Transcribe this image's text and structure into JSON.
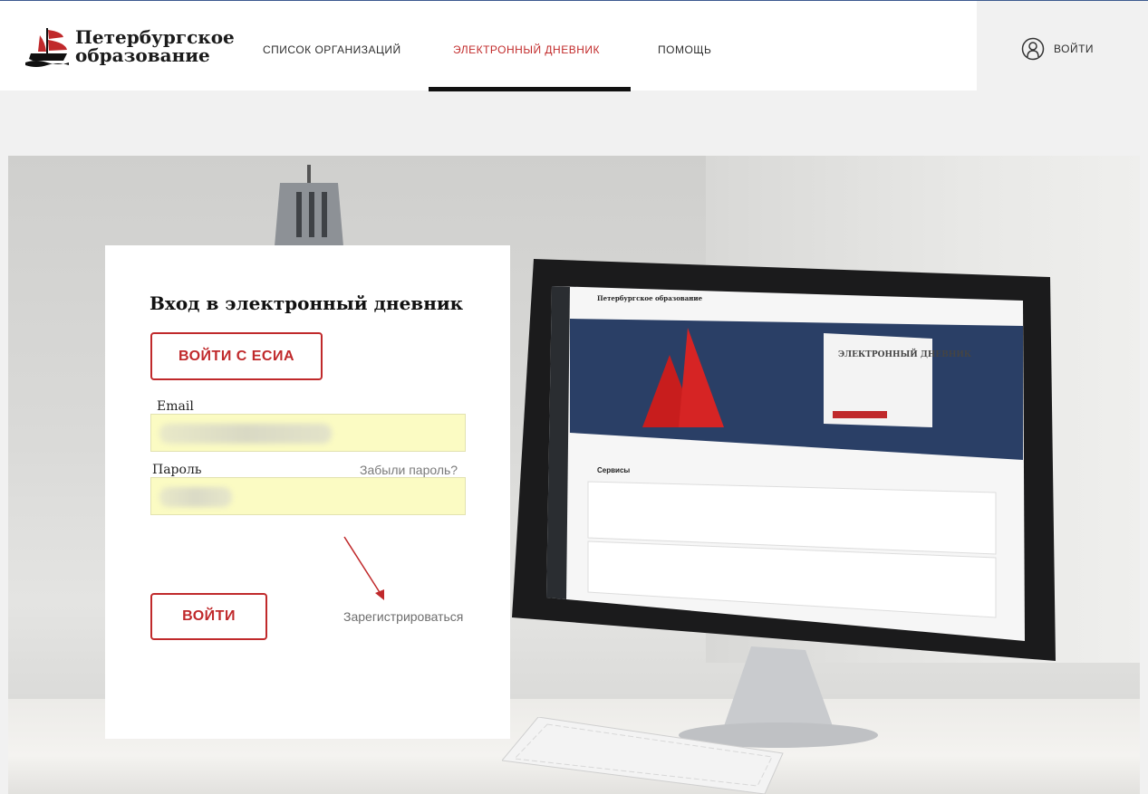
{
  "header": {
    "logo": {
      "line1": "Петербургское",
      "line2": "образование"
    },
    "nav": [
      {
        "label": "СПИСОК ОРГАНИЗАЦИЙ",
        "active": false
      },
      {
        "label": "ЭЛЕКТРОННЫЙ ДНЕВНИК",
        "active": true
      },
      {
        "label": "ПОМОЩЬ",
        "active": false
      }
    ],
    "login_label": "ВОЙТИ"
  },
  "login_form": {
    "title": "Вход в электронный дневник",
    "esia_button": "ВОЙТИ С ЕСИА",
    "email_label": "Email",
    "email_value": "",
    "password_label": "Пароль",
    "password_value": "",
    "forgot_link": "Забыли пароль?",
    "submit_button": "ВОЙТИ",
    "register_link": "Зарегистрироваться"
  },
  "monitor_screen": {
    "site_name": "Петербургское образование",
    "banner_title": "ЭЛЕКТРОННЫЙ ДНЕВНИК",
    "section_title": "Сервисы"
  },
  "colors": {
    "accent": "#c0292b",
    "input_autofill": "#fbfbc3",
    "nav_active": "#c22b2b"
  },
  "icons": [
    "ship-logo-icon",
    "user-circle-icon",
    "arrow-annotation-icon"
  ]
}
